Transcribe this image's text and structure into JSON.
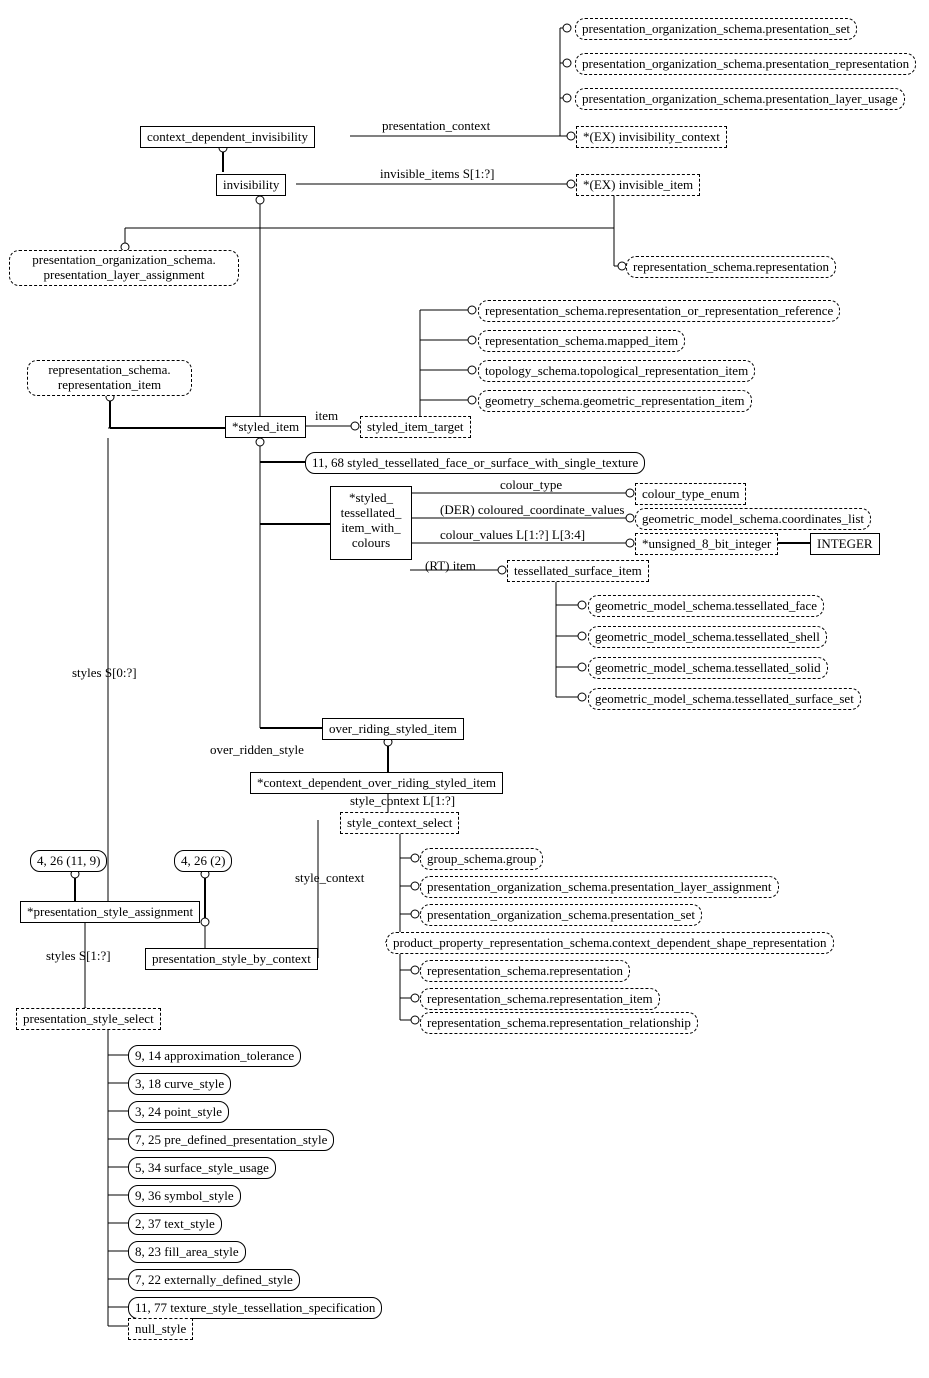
{
  "top_group": {
    "presentation_set": "presentation_organization_schema.presentation_set",
    "presentation_representation": "presentation_organization_schema.presentation_representation",
    "presentation_layer_usage": "presentation_organization_schema.presentation_layer_usage"
  },
  "cdi": "context_dependent_invisibility",
  "invisibility": "invisibility",
  "presentation_context_lbl": "presentation_context",
  "invisibility_context": "*(EX) invisibility_context",
  "invisible_items_lbl": "invisible_items S[1:?]",
  "invisible_item": "*(EX) invisible_item",
  "pla": "presentation_organization_schema.\npresentation_layer_assignment",
  "rep_schema_rep": "representation_schema.representation",
  "rep_or_ref": "representation_schema.representation_or_representation_reference",
  "mapped_item": "representation_schema.mapped_item",
  "topo_rep_item": "topology_schema.topological_representation_item",
  "geom_rep_item": "geometry_schema.geometric_representation_item",
  "rep_item": "representation_schema.\nrepresentation_item",
  "styled_item": "*styled_item",
  "item_lbl": "item",
  "styled_item_target": "styled_item_target",
  "styled_tess_face": "11, 68 styled_tessellated_face_or_surface_with_single_texture",
  "stiwc": "*styled_\ntessellated_\nitem_with_\ncolours",
  "colour_type_lbl": "colour_type",
  "colour_type_enum": "colour_type_enum",
  "der_ccv_lbl": "(DER) coloured_coordinate_values",
  "coords_list": "geometric_model_schema.coordinates_list",
  "colour_values_lbl": "colour_values L[1:?] L[3:4]",
  "u8bit": "*unsigned_8_bit_integer",
  "integer": "INTEGER",
  "rt_item_lbl": "(RT) item",
  "tess_surf_item": "tessellated_surface_item",
  "tess": {
    "face": "geometric_model_schema.tessellated_face",
    "shell": "geometric_model_schema.tessellated_shell",
    "solid": "geometric_model_schema.tessellated_solid",
    "surface_set": "geometric_model_schema.tessellated_surface_set"
  },
  "styles_s0_lbl": "styles S[0:?]",
  "orsi": "over_riding_styled_item",
  "over_ridden_style_lbl": "over_ridden_style",
  "cdorsi": "*context_dependent_over_riding_styled_item",
  "style_context_L_lbl": "style_context L[1:?]",
  "style_context_select": "style_context_select",
  "scs": {
    "group": "group_schema.group",
    "pla": "presentation_organization_schema.presentation_layer_assignment",
    "pset": "presentation_organization_schema.presentation_set",
    "cdsr": "product_property_representation_schema.context_dependent_shape_representation",
    "rep": "representation_schema.representation",
    "rep_item": "representation_schema.representation_item",
    "rep_rel": "representation_schema.representation_relationship"
  },
  "ref426119": "4, 26 (11, 9)",
  "ref4262": "4, 26 (2)",
  "psa": "*presentation_style_assignment",
  "style_context_lbl": "style_context",
  "psbc": "presentation_style_by_context",
  "styles_s1_lbl": "styles S[1:?]",
  "pss": "presentation_style_select",
  "styles": {
    "approx": "9, 14 approximation_tolerance",
    "curve": "3, 18 curve_style",
    "point": "3, 24 point_style",
    "predef": "7, 25 pre_defined_presentation_style",
    "surface": "5, 34 surface_style_usage",
    "symbol": "9, 36 symbol_style",
    "text": "2, 37 text_style",
    "fill": "8, 23 fill_area_style",
    "ext": "7, 22 externally_defined_style",
    "texture": "11, 77 texture_style_tessellation_specification"
  },
  "null_style": "null_style"
}
